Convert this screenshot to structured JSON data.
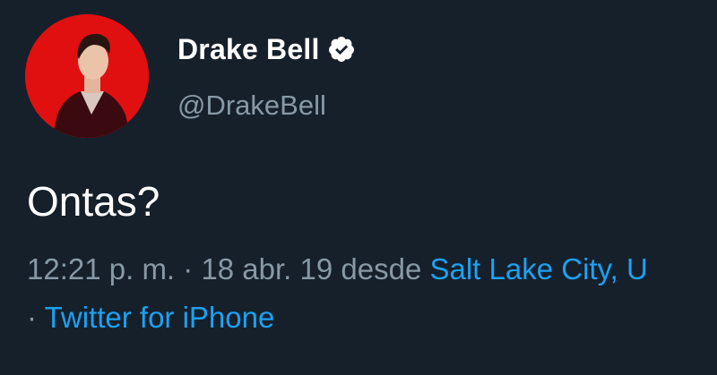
{
  "tweet": {
    "display_name": "Drake Bell",
    "handle": "@DrakeBell",
    "text": "Ontas?",
    "time": "12:21 p. m.",
    "separator": " · ",
    "date": "18 abr. 19",
    "from_word": " desde ",
    "location": "Salt Lake City, U",
    "separator2": "· ",
    "source": "Twitter for iPhone"
  },
  "icons": {
    "avatar": "profile-photo",
    "verified": "verified-badge-icon"
  },
  "colors": {
    "background": "#15202b",
    "primary_text": "#ffffff",
    "secondary_text": "#8899a6",
    "link": "#1da1f2",
    "avatar_bg": "#e00f10"
  }
}
